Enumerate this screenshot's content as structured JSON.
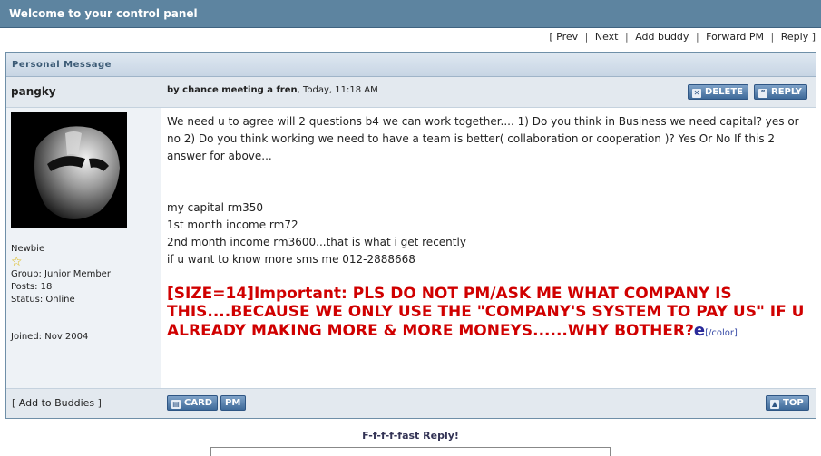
{
  "panel": {
    "title": "Welcome to your control panel"
  },
  "nav": {
    "items": [
      "Prev",
      "Next",
      "Add buddy",
      "Forward PM",
      "Reply"
    ]
  },
  "message": {
    "header": "Personal Message",
    "author": {
      "name": "pangky",
      "rank": "Newbie",
      "group": "Group: Junior Member",
      "posts": "Posts: 18",
      "status": "Status: Online",
      "joined": "Joined: Nov 2004"
    },
    "subject": "by chance meeting a fren",
    "date": ", Today, 11:18 AM",
    "buttons": {
      "delete": "DELETE",
      "reply": "REPLY",
      "card": "CARD",
      "pm": "PM",
      "top": "TOP"
    },
    "body": {
      "para1": "We need u to agree will 2 questions b4 we can work together.... 1) Do you think in Business we need capital? yes or no 2) Do you think working we need to have a team is better( collaboration or cooperation )? Yes Or No If this 2 answer for above...",
      "lines": [
        "my capital rm350",
        "1st month income rm72",
        "2nd month income rm3600...that is what i get recently",
        "if u want to know more sms me 012-2888668"
      ],
      "dashes": "--------------------",
      "important": "[SIZE=14]Important: PLS DO NOT PM/ASK ME WHAT COMPANY IS THIS....BECAUSE WE ONLY USE THE \"COMPANY'S SYSTEM TO PAY US\" IF U ALREADY MAKING MORE & MORE MONEYS......WHY BOTHER?",
      "big_e": "e",
      "color_tag": "[/color]"
    },
    "add_to_buddies": "Add to Buddies"
  },
  "fast_reply": "F-f-f-f-fast Reply!"
}
